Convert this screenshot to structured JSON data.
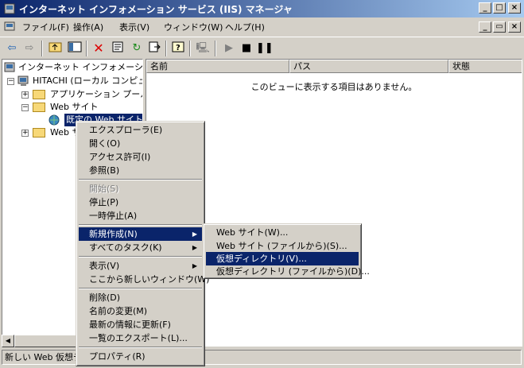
{
  "window": {
    "title": "インターネット インフォメーション サービス (IIS) マネージャ",
    "caption_buttons": [
      "_",
      "□",
      "×"
    ],
    "child_buttons": [
      "_",
      "▭",
      "×"
    ]
  },
  "menubar": [
    "ファイル(F)",
    "操作(A)",
    "表示(V)",
    "ウィンドウ(W)",
    "ヘルプ(H)"
  ],
  "toolbar": {
    "icons": [
      "back-icon",
      "forward-icon",
      "up-icon",
      "show-hide-tree-icon",
      "delete-icon",
      "properties-icon",
      "refresh-icon",
      "export-icon",
      "help-icon",
      "computer-icon",
      "play-icon",
      "stop-icon",
      "pause-icon"
    ]
  },
  "tree": {
    "items": [
      {
        "label": "インターネット インフォメーション サ"
      },
      {
        "label": "HITACHI (ローカル コンピュ"
      },
      {
        "label": "アプリケーション プール"
      },
      {
        "label": "Web サイト"
      },
      {
        "label": "既定の Web サイト"
      },
      {
        "label": "Web サ"
      }
    ]
  },
  "list": {
    "columns": [
      "名前",
      "パス",
      "状態"
    ],
    "empty_message": "このビューに表示する項目はありません。"
  },
  "context_menu": {
    "items": [
      "エクスプローラ(E)",
      "開く(O)",
      "アクセス許可(I)",
      "参照(B)",
      "開始(S)",
      "停止(P)",
      "一時停止(A)",
      "新規作成(N)",
      "すべてのタスク(K)",
      "表示(V)",
      "ここから新しいウィンドウ(W)",
      "削除(D)",
      "名前の変更(M)",
      "最新の情報に更新(F)",
      "一覧のエクスポート(L)...",
      "プロパティ(R)"
    ]
  },
  "submenu": {
    "items": [
      "Web サイト(W)...",
      "Web サイト (ファイルから)(S)...",
      "仮想ディレクトリ(V)...",
      "仮想ディレクトリ (ファイルから)(D)..."
    ]
  },
  "status": {
    "text": "新しい Web 仮想デ"
  }
}
